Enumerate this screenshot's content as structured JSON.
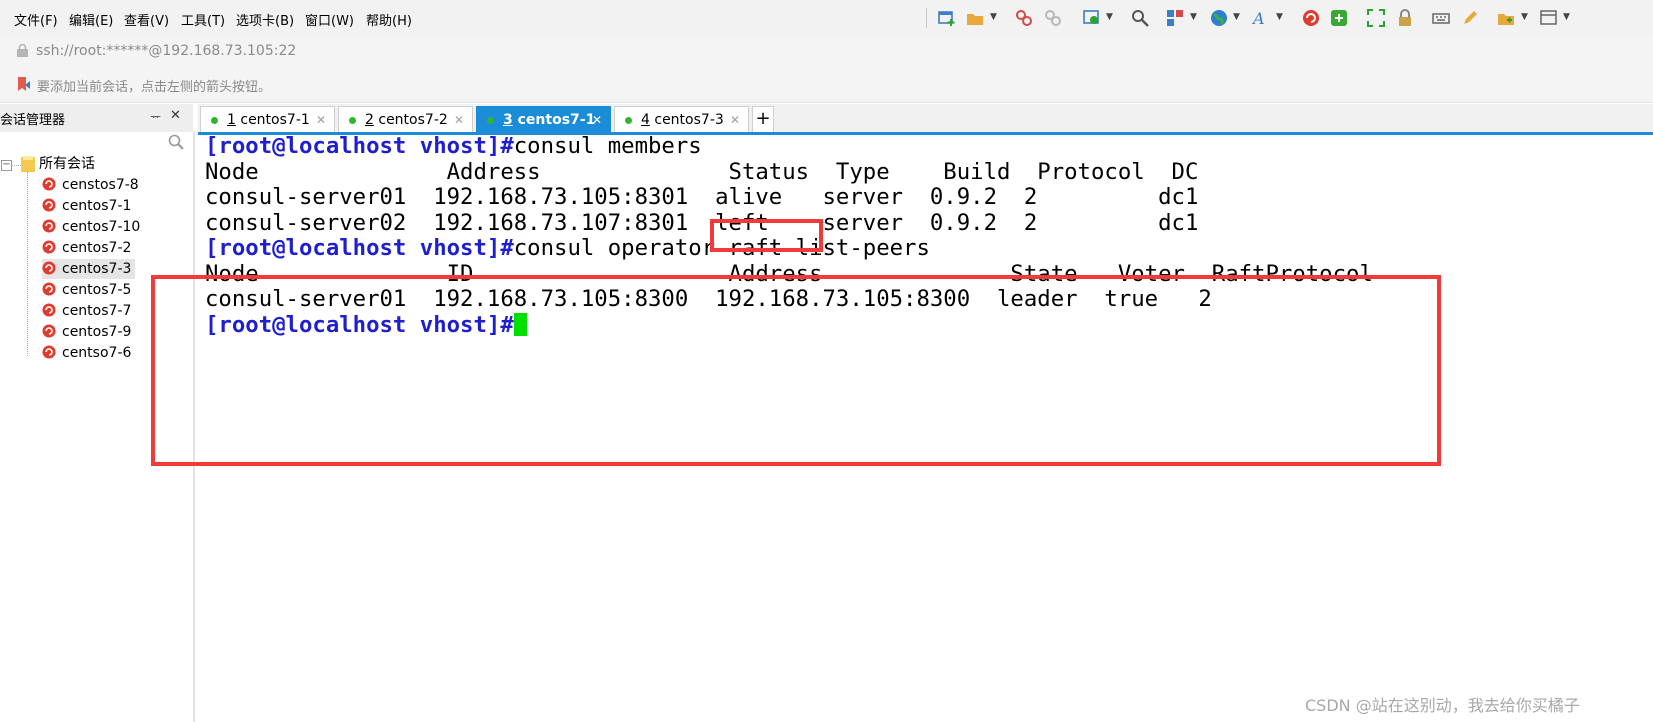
{
  "menu": [
    "文件(F)",
    "编辑(E)",
    "查看(V)",
    "工具(T)",
    "选项卡(B)",
    "窗口(W)",
    "帮助(H)"
  ],
  "address": "ssh://root:******@192.168.73.105:22",
  "hint": "要添加当前会话，点击左侧的箭头按钮。",
  "session_manager": {
    "title": "会话管理器",
    "pin": "ᅲ",
    "close": "✕",
    "root": "所有会话",
    "items": [
      "censtos7-8",
      "centos7-1",
      "centos7-10",
      "centos7-2",
      "centos7-3",
      "centos7-5",
      "centos7-7",
      "centos7-9",
      "centso7-6"
    ]
  },
  "tabs": [
    {
      "num": "1",
      "name": "centos7-1"
    },
    {
      "num": "2",
      "name": "centos7-2"
    },
    {
      "num": "3",
      "name": "centos7-1"
    },
    {
      "num": "4",
      "name": "centos7-3"
    }
  ],
  "add_tab": "+",
  "terminal": {
    "prompt": "[root@localhost vhost]#",
    "cmd1": "consul members",
    "members_header": "Node              Address              Status  Type    Build  Protocol  DC",
    "members_row1": "consul-server01  192.168.73.105:8301  alive   server  0.9.2  2         dc1",
    "members_row2": "consul-server02  192.168.73.107:8301  left    server  0.9.2  2         dc1",
    "cmd2": "consul operator raft list-peers",
    "peers_header": "Node              ID                   Address              State   Voter  RaftProtocol",
    "peers_row1": "consul-server01  192.168.73.105:8300  192.168.73.105:8300  leader  true   2"
  },
  "watermark": "CSDN @站在这别动，我去给你买橘子",
  "colors": {
    "prompt": "#1f1fcf",
    "cursor": "#00e000",
    "highlight": "#f23a3a",
    "tab_active": "#1a8cd8"
  }
}
